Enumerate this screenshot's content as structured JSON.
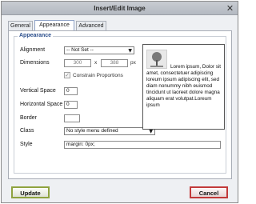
{
  "dialog": {
    "title": "Insert/Edit Image",
    "close_icon": "close-icon"
  },
  "tabs": [
    {
      "label": "General",
      "active": false
    },
    {
      "label": "Appearance",
      "active": true
    },
    {
      "label": "Advanced",
      "active": false
    }
  ],
  "appearance": {
    "legend": "Appearance",
    "alignment": {
      "label": "Alignment",
      "value": "-- Not Set --"
    },
    "dimensions": {
      "label": "Dimensions",
      "width": "300",
      "sep": "x",
      "height": "388",
      "unit": "px"
    },
    "constrain": {
      "label": "Constrain Proportions",
      "checked": true
    },
    "vspace": {
      "label": "Vertical Space",
      "value": "0"
    },
    "hspace": {
      "label": "Horizontal Space",
      "value": "0"
    },
    "border": {
      "label": "Border",
      "value": ""
    },
    "class": {
      "label": "Class",
      "value": "No style menu defined"
    },
    "style": {
      "label": "Style",
      "value": "margin: 0px;"
    }
  },
  "preview": {
    "text": "Lorem ipsum, Dolor sit amet, consectetuer adipiscing loreum ipsum adipiscing elit, sed diam nonummy nibh euismod tincidunt ut laoreet dolore magna aliquam erat volutpat.Loreum ipsum"
  },
  "buttons": {
    "update": "Update",
    "cancel": "Cancel"
  },
  "colors": {
    "update_border": "#8fa33f",
    "cancel_border": "#c23a3a",
    "legend_text": "#2c4f8c"
  }
}
